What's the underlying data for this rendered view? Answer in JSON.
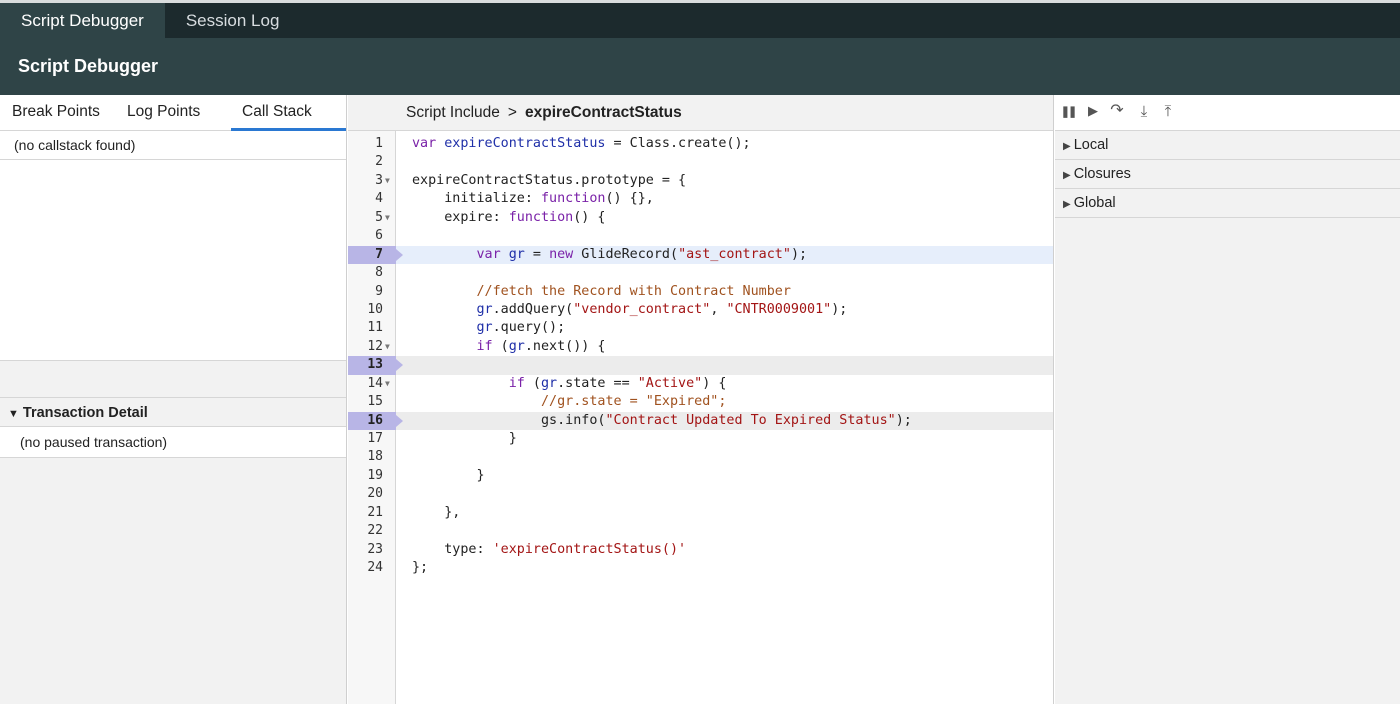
{
  "top_tabs": [
    {
      "label": "Script Debugger"
    },
    {
      "label": "Session Log"
    }
  ],
  "title": "Script Debugger",
  "left": {
    "tabs": [
      {
        "label": "Break Points"
      },
      {
        "label": "Log Points"
      },
      {
        "label": "Call Stack"
      }
    ],
    "callstack_empty": "(no callstack found)",
    "transaction_title": "Transaction Detail",
    "transaction_empty": "(no paused transaction)"
  },
  "breadcrumb": {
    "parent": "Script Include",
    "separator": ">",
    "current": "expireContractStatus"
  },
  "code": {
    "line_numbers": [
      "1",
      "2",
      "3",
      "4",
      "5",
      "6",
      "7",
      "8",
      "9",
      "10",
      "11",
      "12",
      "13",
      "14",
      "15",
      "16",
      "17",
      "18",
      "19",
      "20",
      "21",
      "22",
      "23",
      "24"
    ],
    "breakpoint_lines": [
      "7",
      "13",
      "16"
    ]
  },
  "right": {
    "controls": [
      {
        "icon": "pause-icon",
        "glyph": "❚❚"
      },
      {
        "icon": "resume-icon",
        "glyph": "▶"
      },
      {
        "icon": "step-over-icon",
        "glyph": "↷"
      },
      {
        "icon": "step-into-icon",
        "glyph": "⤓"
      },
      {
        "icon": "step-out-icon",
        "glyph": "⤒"
      }
    ],
    "scopes": [
      {
        "label": "Local"
      },
      {
        "label": "Closures"
      },
      {
        "label": "Global"
      }
    ]
  },
  "colors": {
    "topbar": "#1c2a2d",
    "titlebar": "#2f4447",
    "active_tab_underline": "#2a78d2",
    "breakpoint": "#b8b5e6"
  }
}
